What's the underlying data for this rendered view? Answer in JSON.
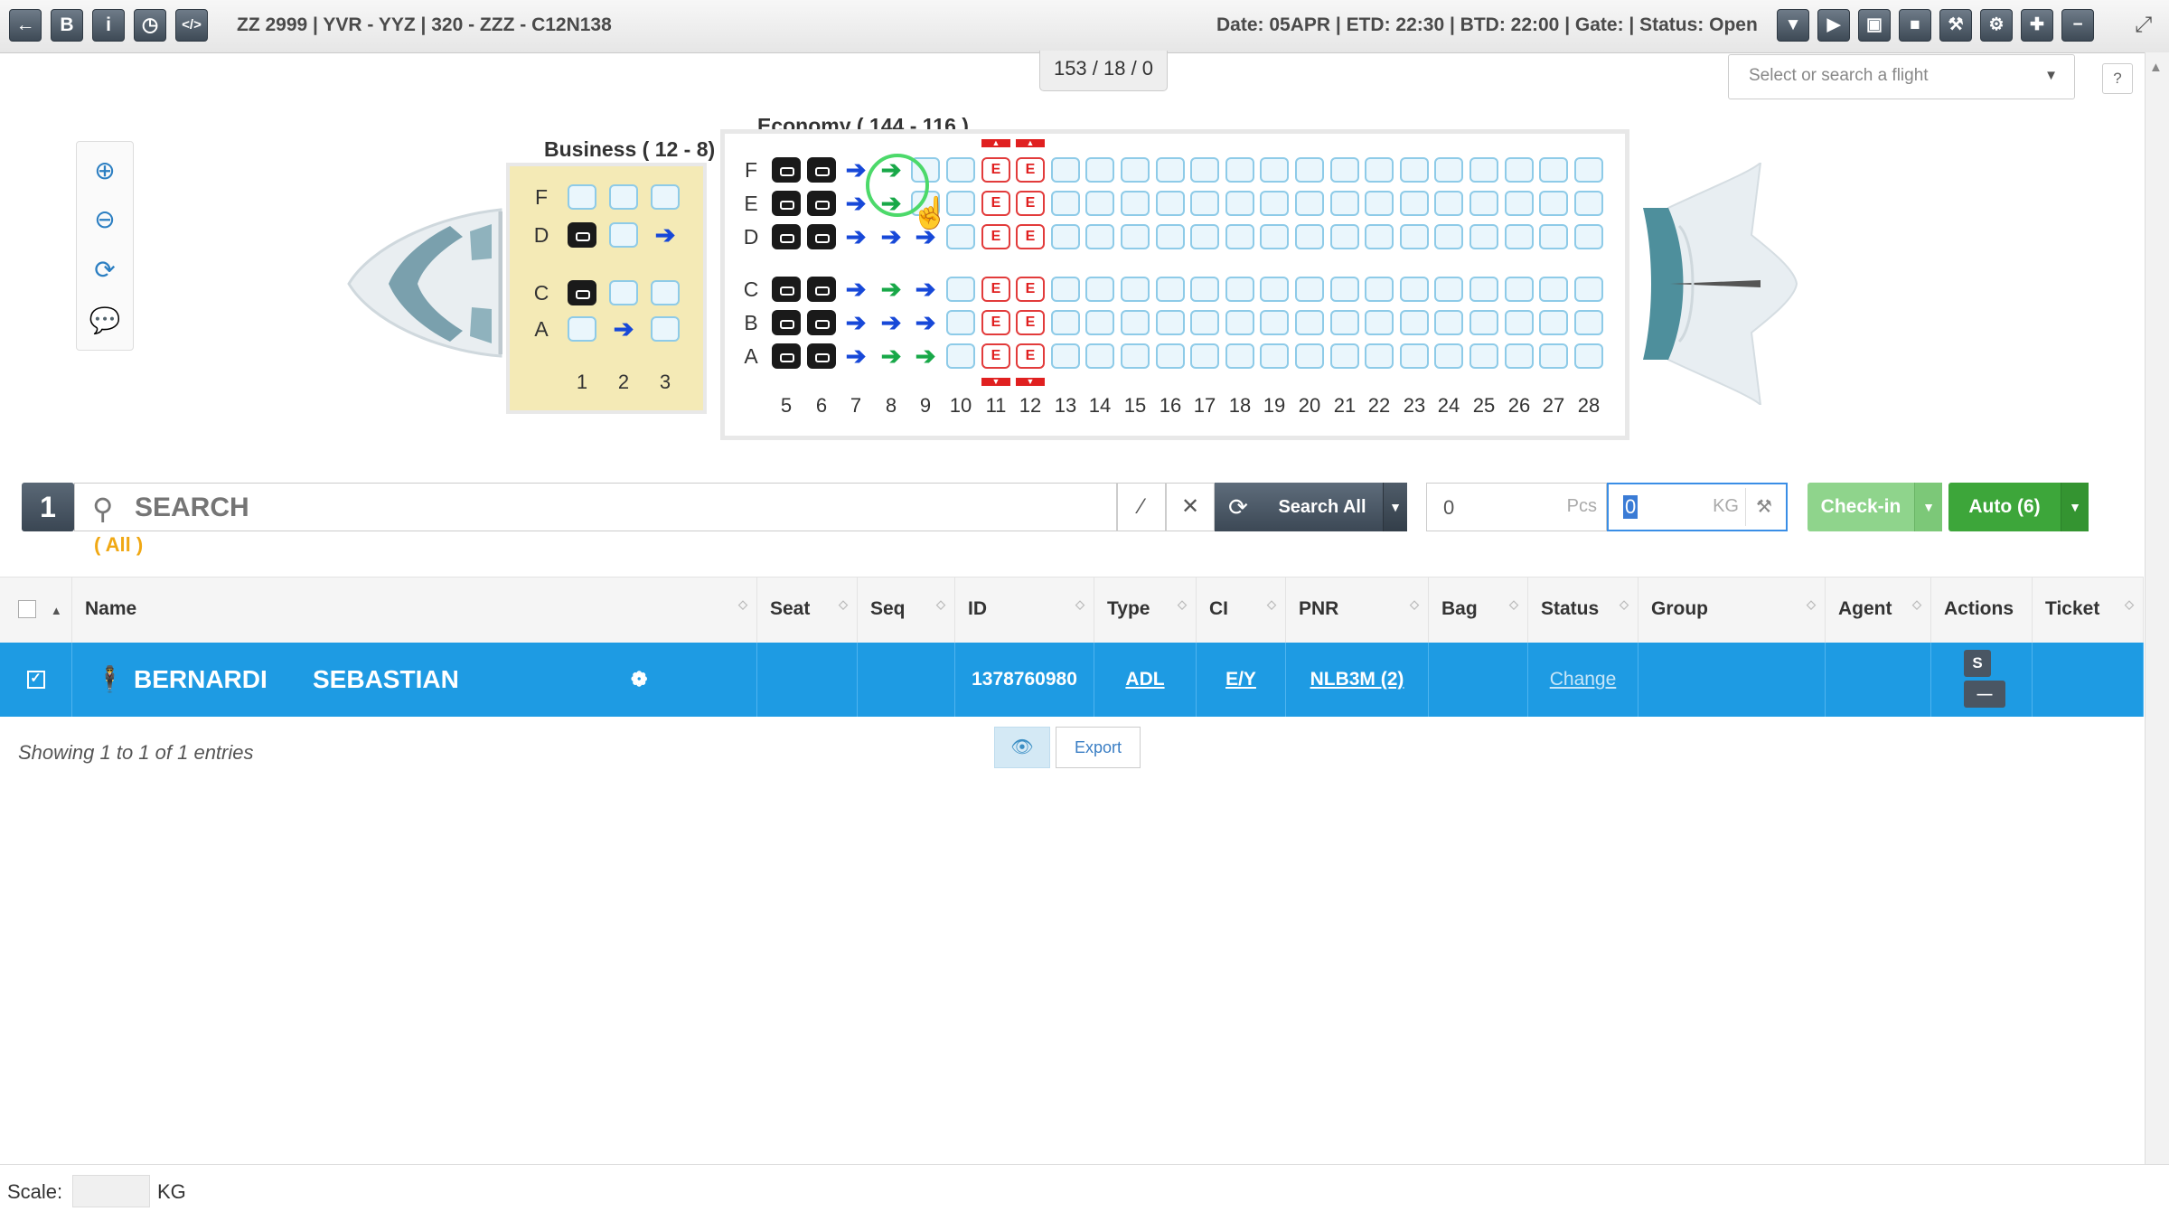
{
  "toolbar": {
    "left_buttons": [
      "back-icon",
      "bold-b-icon",
      "info-icon",
      "clock-icon",
      "code-icon"
    ],
    "left_glyphs": [
      "←",
      "B",
      "i",
      "◷",
      "</>"
    ],
    "flight_title": "ZZ 2999 | YVR - YYZ | 320 - ZZZ - C12N138",
    "flight_info": "Date: 05APR | ETD: 22:30 | BTD: 22:00 | Gate: | Status: Open",
    "right_buttons": [
      "filter-icon",
      "play-icon",
      "briefcase-icon",
      "lock-icon",
      "wrench-icon",
      "gears-icon",
      "add-user-icon",
      "minus-icon"
    ],
    "right_glyphs": [
      "▼",
      "▶",
      "▣",
      "■",
      "⚒",
      "⚙",
      "✚",
      "−"
    ]
  },
  "counter": "153 / 18 / 0",
  "flight_select": {
    "placeholder": "Select or search a flight"
  },
  "help": "?",
  "seatmap": {
    "business": {
      "label": "Business ( 12 - 8)",
      "columns": [
        "1",
        "2",
        "3"
      ],
      "rows": [
        {
          "letter": "F",
          "seats": [
            "av",
            "av",
            "av"
          ]
        },
        {
          "letter": "D",
          "seats": [
            "occ",
            "av",
            "blu"
          ]
        },
        {
          "letter": "C",
          "seats": [
            "occ",
            "av",
            "av"
          ]
        },
        {
          "letter": "A",
          "seats": [
            "av",
            "blu",
            "av"
          ]
        }
      ]
    },
    "economy": {
      "label": "Economy ( 144 - 116 )",
      "columns": [
        "5",
        "6",
        "7",
        "8",
        "9",
        "10",
        "11",
        "12",
        "13",
        "14",
        "15",
        "16",
        "17",
        "18",
        "19",
        "20",
        "21",
        "22",
        "23",
        "24",
        "25",
        "26",
        "27",
        "28"
      ],
      "exit_rows": [
        "11",
        "12"
      ],
      "exit_seat_letter": "E",
      "rows": [
        {
          "letter": "F",
          "seats": [
            "occ",
            "occ",
            "blu",
            "grn",
            "av",
            "av",
            "ex",
            "ex",
            "av",
            "av",
            "av",
            "av",
            "av",
            "av",
            "av",
            "av",
            "av",
            "av",
            "av",
            "av",
            "av",
            "av",
            "av",
            "av"
          ]
        },
        {
          "letter": "E",
          "seats": [
            "occ",
            "occ",
            "blu",
            "grn",
            "av",
            "av",
            "ex",
            "ex",
            "av",
            "av",
            "av",
            "av",
            "av",
            "av",
            "av",
            "av",
            "av",
            "av",
            "av",
            "av",
            "av",
            "av",
            "av",
            "av"
          ]
        },
        {
          "letter": "D",
          "seats": [
            "occ",
            "occ",
            "blu",
            "blu",
            "blu",
            "av",
            "ex",
            "ex",
            "av",
            "av",
            "av",
            "av",
            "av",
            "av",
            "av",
            "av",
            "av",
            "av",
            "av",
            "av",
            "av",
            "av",
            "av",
            "av"
          ]
        },
        {
          "letter": "C",
          "seats": [
            "occ",
            "occ",
            "blu",
            "grn",
            "blu",
            "av",
            "ex",
            "ex",
            "av",
            "av",
            "av",
            "av",
            "av",
            "av",
            "av",
            "av",
            "av",
            "av",
            "av",
            "av",
            "av",
            "av",
            "av",
            "av"
          ]
        },
        {
          "letter": "B",
          "seats": [
            "occ",
            "occ",
            "blu",
            "blu",
            "blu",
            "av",
            "ex",
            "ex",
            "av",
            "av",
            "av",
            "av",
            "av",
            "av",
            "av",
            "av",
            "av",
            "av",
            "av",
            "av",
            "av",
            "av",
            "av",
            "av"
          ]
        },
        {
          "letter": "A",
          "seats": [
            "occ",
            "occ",
            "blu",
            "grn",
            "grn",
            "av",
            "ex",
            "ex",
            "av",
            "av",
            "av",
            "av",
            "av",
            "av",
            "av",
            "av",
            "av",
            "av",
            "av",
            "av",
            "av",
            "av",
            "av",
            "av"
          ]
        }
      ]
    }
  },
  "search": {
    "group_number": "1",
    "placeholder": "SEARCH",
    "filter": "( All )",
    "search_all_label": "Search All",
    "pcs_value": "0",
    "pcs_unit": "Pcs",
    "kg_value": "0",
    "kg_unit": "KG",
    "checkin_label": "Check-in",
    "auto_label": "Auto (6)"
  },
  "table": {
    "headers": [
      "Name",
      "Seat",
      "Seq",
      "ID",
      "Type",
      "CI",
      "PNR",
      "Bag",
      "Status",
      "Group",
      "Agent",
      "Actions",
      "Ticket"
    ],
    "row": {
      "last_name": "BERNARDI",
      "first_name": "SEBASTIAN",
      "seat": "",
      "seq": "",
      "id": "1378760980",
      "type": "ADL",
      "ci": "E/Y",
      "pnr": "NLB3M (2)",
      "bag": "",
      "status": "Change",
      "group": "",
      "agent": "",
      "action_s": "S",
      "action_minus": "—",
      "ticket": ""
    },
    "showing": "Showing 1 to 1 of 1 entries",
    "export_label": "Export"
  },
  "footer": {
    "scale_label": "Scale:",
    "scale_unit": "KG"
  },
  "colors": {
    "selected_row": "#1e9be3",
    "checkin_green": "#3da63a",
    "exit_red": "#e02020",
    "filter_orange": "#f0a814"
  }
}
